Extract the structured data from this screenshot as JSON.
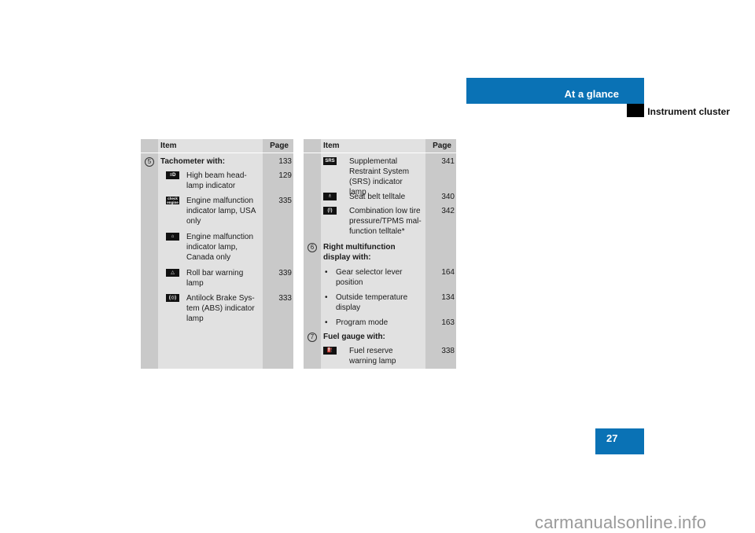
{
  "header": {
    "section_title": "At a glance",
    "subsection_title": "Instrument cluster",
    "accent_color": "#0a72b5"
  },
  "page_number": "27",
  "table_headers": {
    "item": "Item",
    "page": "Page"
  },
  "left_table": {
    "rows": [
      {
        "type": "group",
        "num": "5",
        "label": "Tachometer with:",
        "page": "133"
      },
      {
        "type": "icon",
        "icon": "high-beam-icon",
        "glyph": "≡D",
        "label": "High beam head-lamp indicator",
        "page": "129"
      },
      {
        "type": "icon",
        "icon": "check-engine-icon",
        "glyph": "check engine",
        "label": "Engine malfunction indicator lamp, USA only",
        "page": "335"
      },
      {
        "type": "icon",
        "icon": "engine-icon",
        "glyph": "⌂",
        "label": "Engine malfunction indicator lamp, Canada only",
        "page": ""
      },
      {
        "type": "icon",
        "icon": "roll-bar-icon",
        "glyph": "△",
        "label": "Roll bar warning lamp",
        "page": "339"
      },
      {
        "type": "icon",
        "icon": "abs-icon",
        "glyph": "(◎)",
        "label": "Antilock Brake Sys-tem (ABS) indicator lamp",
        "page": "333"
      }
    ]
  },
  "right_table": {
    "rows": [
      {
        "type": "icon",
        "icon": "srs-icon",
        "glyph": "SRS",
        "label": "Supplemental Restraint System (SRS) indicator lamp",
        "page": "341"
      },
      {
        "type": "icon",
        "icon": "seat-belt-icon",
        "glyph": "♗",
        "label": "Seat belt telltale",
        "page": "340"
      },
      {
        "type": "icon",
        "icon": "tire-pressure-icon",
        "glyph": "(!)",
        "label": "Combination low tire pressure/TPMS mal-function telltale*",
        "page": "342"
      },
      {
        "type": "group",
        "num": "6",
        "label": "Right multifunction display with:",
        "page": ""
      },
      {
        "type": "bullet",
        "label": "Gear selector lever position",
        "page": "164"
      },
      {
        "type": "bullet",
        "label": "Outside temperature display",
        "page": "134"
      },
      {
        "type": "bullet",
        "label": "Program mode",
        "page": "163"
      },
      {
        "type": "group",
        "num": "7",
        "label": "Fuel gauge with:",
        "page": ""
      },
      {
        "type": "icon",
        "icon": "fuel-reserve-icon",
        "glyph": "⛽",
        "label": "Fuel reserve warning lamp",
        "page": "338"
      }
    ]
  },
  "watermark": "carmanualsonline.info"
}
